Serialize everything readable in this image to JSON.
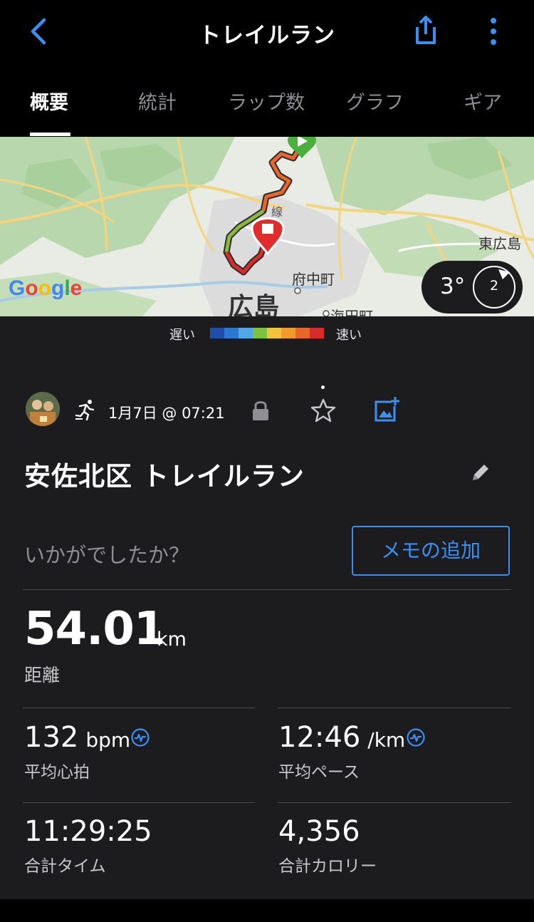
{
  "header": {
    "title": "トレイルラン",
    "back_icon": "chevron-left-icon",
    "share_icon": "share-icon",
    "more_icon": "more-vertical-icon"
  },
  "tabs": [
    {
      "label": "概要",
      "active": true
    },
    {
      "label": "統計",
      "active": false
    },
    {
      "label": "ラップ数",
      "active": false
    },
    {
      "label": "グラフ",
      "active": false
    },
    {
      "label": "ギア",
      "active": false
    }
  ],
  "map": {
    "labels": {
      "city": "広島",
      "town1": "府中町",
      "town2": "東広島",
      "town3": "海田町",
      "line": "線"
    },
    "provider": "Google",
    "weather": {
      "temp": "3°",
      "wind": "2"
    }
  },
  "legend": {
    "slow": "遅い",
    "fast": "速い",
    "colors": [
      "#1f4fa8",
      "#2c79d4",
      "#52a6e8",
      "#7cc23e",
      "#f2c33d",
      "#f39a2e",
      "#e8662a",
      "#d62c2c"
    ]
  },
  "activity": {
    "date": "1月7日 @ 07:21",
    "title": "安佐北区 トレイルラン",
    "memo_question": "いかがでしたか？",
    "memo_button": "メモの追加"
  },
  "stats": {
    "distance": {
      "value": "54.01",
      "unit": "km",
      "label": "距離"
    },
    "avg_hr": {
      "value": "132",
      "unit": "bpm",
      "label": "平均心拍"
    },
    "avg_pace": {
      "value": "12:46",
      "unit": "/km",
      "label": "平均ペース"
    },
    "total_time": {
      "value": "11:29:25",
      "label": "合計タイム"
    },
    "calories": {
      "value": "4,356",
      "label": "合計カロリー"
    }
  },
  "colors": {
    "accent": "#3a8ff0",
    "background": "#1c1c1e"
  }
}
